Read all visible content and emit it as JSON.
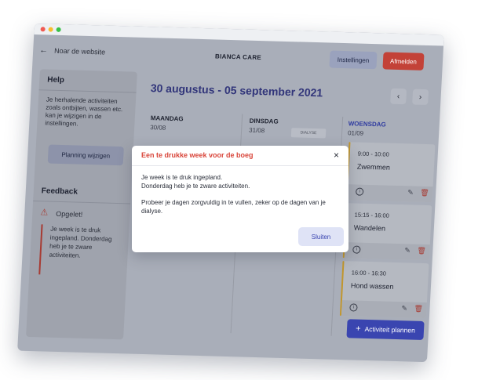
{
  "header": {
    "back_label": "Noar de website",
    "brand": "BIANCA CARE",
    "settings_label": "Instellingen",
    "logout_label": "Afmelden"
  },
  "sidebar": {
    "help_title": "Help",
    "help_text": "Je herhalende activiteiten zoals ontbijten, wassen etc. kan je wijzigen in de instellingen.",
    "plan_button": "Planning wijzigen",
    "feedback_title": "Feedback",
    "warning_title": "Opgelet!",
    "warning_text": "Je week is te druk ingepland. Donderdag heb je te zware activiteiten."
  },
  "calendar": {
    "range": "30 augustus - 05 september 2021",
    "days": [
      {
        "name": "MAANDAG",
        "date": "30/08"
      },
      {
        "name": "DINSDAG",
        "date": "31/08"
      },
      {
        "name": "WOENSDAG",
        "date": "01/09"
      }
    ],
    "tag": "DIALYSE",
    "cards": [
      {
        "time": "9:00 - 10:00",
        "title": "Zwemmen"
      },
      {
        "time": "15:15 - 16:00",
        "title": "Wandelen"
      },
      {
        "time": "16:00 - 16:30",
        "title": "Hond wassen"
      }
    ],
    "add_button": "Activiteit plannen"
  },
  "modal": {
    "title": "Een te drukke week voor de boeg",
    "line1": "Je week is te druk ingepland.",
    "line2": "Donderdag heb je te zware activiteiten.",
    "line3": "Probeer je dagen zorgvuldig in te vullen, zeker op de dagen van je dialyse.",
    "close_button": "Sluiten"
  },
  "colors": {
    "accent": "#3a45b0",
    "danger": "#d9453a",
    "activity_bar": "#c1962d"
  },
  "icons": [
    "back-arrow-icon",
    "chevron-left-icon",
    "chevron-right-icon",
    "warning-icon",
    "info-icon",
    "edit-icon",
    "delete-icon",
    "close-icon",
    "plus-icon"
  ]
}
